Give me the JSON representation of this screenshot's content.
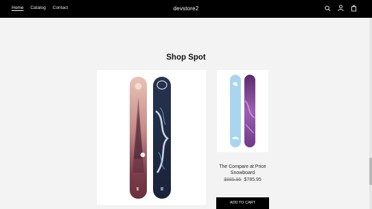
{
  "header": {
    "nav": [
      {
        "label": "Home",
        "active": true
      },
      {
        "label": "Catalog",
        "active": false
      },
      {
        "label": "Contact",
        "active": false
      }
    ],
    "brand": "devstore2",
    "icons": [
      "search-icon",
      "account-icon",
      "cart-icon"
    ]
  },
  "section": {
    "title": "Shop Spot"
  },
  "products": {
    "featured_image": "snowboards-pink-and-navy",
    "small": {
      "image": "snowboards-light-blue-and-purple",
      "title": "The Compare at Price Snowboard",
      "compare_price": "$885.95",
      "price": "$785.95",
      "button": "ADD TO CART"
    }
  },
  "colors": {
    "header_bg": "#000000",
    "page_bg": "#f3f3f3"
  }
}
